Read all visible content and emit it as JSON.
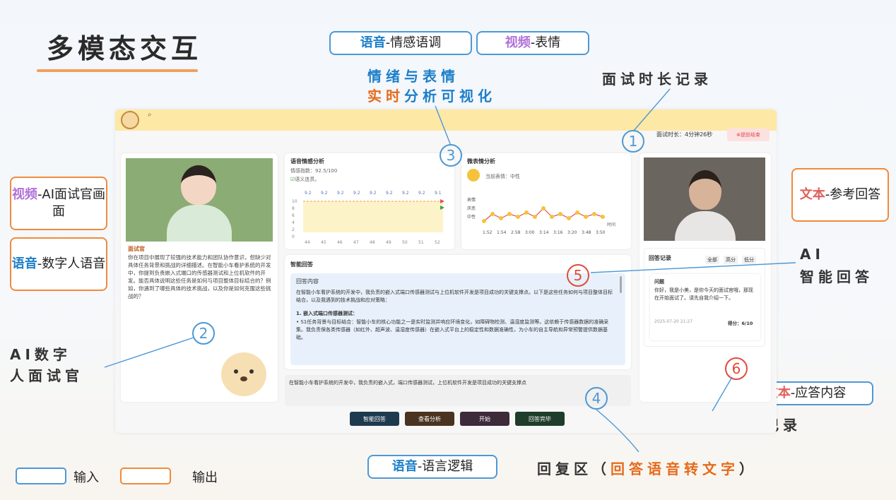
{
  "title": "多模态交互",
  "tags": {
    "voice_emotion": {
      "kw": "语音",
      "rest": "-情感语调"
    },
    "video_expression": {
      "kw": "视频",
      "rest": "-表情"
    },
    "video_ai": {
      "kw": "视频",
      "rest": "-AI面试官画面"
    },
    "voice_digital": {
      "kw": "语音",
      "rest": "-数字人语音"
    },
    "text_reference": {
      "kw": "文本",
      "rest": "-参考回答"
    },
    "text_answer": {
      "kw": "文本",
      "rest": "-应答内容"
    },
    "voice_logic": {
      "kw": "语音",
      "rest": "-语言逻辑"
    }
  },
  "annotations": {
    "emotion_line1": "情绪与表情",
    "emotion_line2_a": "实时",
    "emotion_line2_b": "分析可视化",
    "duration_record": "面试时长记录",
    "ai_answer_1": "AI",
    "ai_answer_2": "智能回答",
    "ai_interviewer_1": "AI数字",
    "ai_interviewer_2": "人面试官",
    "score_record": "问题得分记录",
    "reply_area_a": "回复区（",
    "reply_area_b": "回答语音转文字",
    "reply_area_c": "）"
  },
  "numbers": [
    "1",
    "2",
    "3",
    "4",
    "5",
    "6"
  ],
  "legend": {
    "input": "输入",
    "output": "输出"
  },
  "app": {
    "duration_label": "面试时长：4分钟26秒",
    "end_button": "⊗提前结束",
    "interviewer_label": "面试官",
    "interviewer_text": "你在项目中展现了较强的技术能力和团队协作意识，但缺少对具体任务背景和挑战的详细描述。在智能小车看护系统的开发中，你提到负责嵌入式端口的传感器测试和上位机软件的开发。能否具体说明这些任务是如何与项目整体目标结合的？例如，你遇到了哪些具体的技术挑战，以及你是如何克服这些挑战的？",
    "voice_title": "语音情感分析",
    "voice_index": "情感指数：92.5/100",
    "voice_status": "语义连贯。",
    "voice_values": [
      "9.2",
      "9.2",
      "9.2",
      "9.2",
      "9.2",
      "9.2",
      "9.2",
      "9.2",
      "9.1"
    ],
    "voice_yticks": [
      "10",
      "8",
      "6",
      "4",
      "2",
      "0"
    ],
    "voice_xticks": [
      "44",
      "45",
      "46",
      "47",
      "48",
      "49",
      "50",
      "51",
      "52"
    ],
    "face_title": "微表情分析",
    "face_current": "当前表情：中性",
    "face_ylabels": [
      "表情",
      "厌恶",
      "中性"
    ],
    "face_xticks": [
      "1:52",
      "1:54",
      "2:58",
      "3:00",
      "3:14",
      "3:16",
      "3:20",
      "3:48",
      "3:50"
    ],
    "face_xlabel": "时间",
    "smart_title": "智能回答",
    "smart_sub": "回答内容",
    "smart_p1": "在智能小车看护系统的开发中，我负责的嵌入式端口传感器测试与上位机软件开发是项目成功的关键支撑点。以下是这些任务如何与项目整体目标结合，以及我遇到的技术挑战和应对策略：",
    "smart_h1": "1. 嵌入式端口传感器测试：",
    "smart_p2": "• S1任务背景与目标结合：智能小车的核心功能之一是实时监测并响应环境变化，如障碍物检测、温湿度监测等。这依赖于传感器数据的准确采集。我负责保各类传感器（如红外、超声波、温湿度传感器）在嵌入式平台上的稳定性和数据准确性，为小车的自主导航和异常预警提供数据基础。",
    "reply_text": "在智能小车看护系统的开发中，我负责的嵌入式，端口传感器测试，上位机软件开发是项目成功的关键支撑点",
    "buttons": [
      "智能回答",
      "查看分析",
      "开始",
      "回答完毕"
    ],
    "record_title": "回答记录",
    "record_filters": [
      "全部",
      "高分",
      "低分"
    ],
    "record_q": "问题",
    "record_text": "你好，我是小美，是你今天的面试官哦，那现在开始面试了。请先自我介绍一下。",
    "record_time": "2025-07-20 21:27",
    "record_score": "得分：6/10"
  },
  "colors": {
    "input_border": "#4d98d6",
    "output_border": "#f08a3c",
    "accent_blue": "#1c7fc9",
    "accent_orange": "#e66a1a"
  }
}
